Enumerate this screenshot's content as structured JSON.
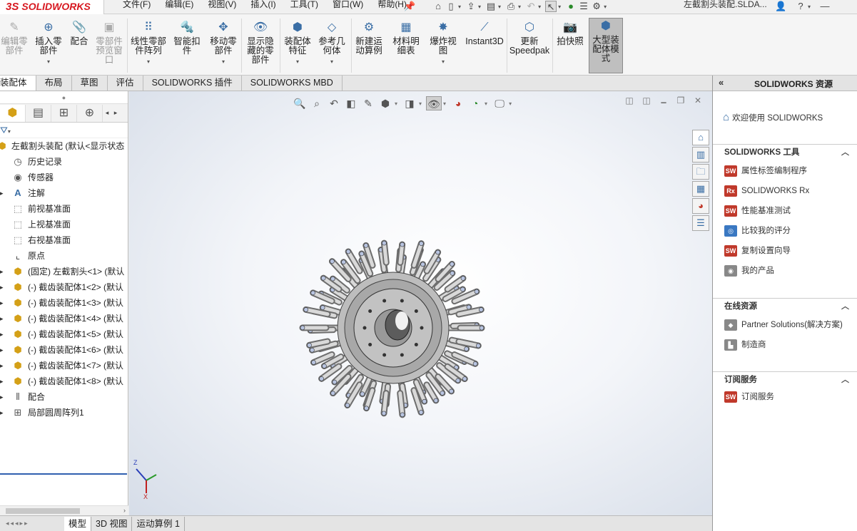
{
  "app": {
    "logo_prefix": "3S",
    "logo_text": "SOLIDWORKS",
    "document_title": "左截割头装配.SLDA..."
  },
  "menu": [
    "文件(F)",
    "编辑(E)",
    "视图(V)",
    "插入(I)",
    "工具(T)",
    "窗口(W)",
    "帮助(H)"
  ],
  "ribbon": {
    "items": [
      {
        "id": "edit-component",
        "label": "编辑零\n部件",
        "disabled": true
      },
      {
        "id": "insert-component",
        "label": "插入零\n部件",
        "dropdown": true
      },
      {
        "id": "mate",
        "label": "配合"
      },
      {
        "id": "component-preview",
        "label": "零部件\n预览窗\n口",
        "disabled": true
      },
      {
        "id": "linear-pattern",
        "label": "线性零部\n件阵列",
        "dropdown": true
      },
      {
        "id": "smart-fasteners",
        "label": "智能扣\n件"
      },
      {
        "id": "move-component",
        "label": "移动零\n部件",
        "dropdown": true
      },
      {
        "id": "show-hidden",
        "label": "显示隐\n藏的零\n部件"
      },
      {
        "id": "assembly-features",
        "label": "装配体\n特征",
        "dropdown": true
      },
      {
        "id": "reference-geometry",
        "label": "参考几\n何体",
        "dropdown": true
      },
      {
        "id": "new-motion-study",
        "label": "新建运\n动算例"
      },
      {
        "id": "bom",
        "label": "材料明\n细表"
      },
      {
        "id": "exploded-view",
        "label": "爆炸视\n图",
        "dropdown": true
      },
      {
        "id": "instant3d",
        "label": "Instant3D"
      },
      {
        "id": "update-speedpak",
        "label": "更新\nSpeedpak"
      },
      {
        "id": "snapshot",
        "label": "拍快照"
      },
      {
        "id": "large-assembly",
        "label": "大型装\n配体模\n式",
        "active": true
      }
    ]
  },
  "tabs": [
    "装配体",
    "布局",
    "草图",
    "评估",
    "SOLIDWORKS 插件",
    "SOLIDWORKS MBD"
  ],
  "feature_tree": {
    "root": "左截割头装配  (默认<显示状态",
    "nodes": [
      {
        "label": "历史记录",
        "icon": "history-icon"
      },
      {
        "label": "传感器",
        "icon": "sensor-icon"
      },
      {
        "label": "注解",
        "icon": "annotation-icon",
        "expandable": true
      },
      {
        "label": "前视基准面",
        "icon": "plane-icon"
      },
      {
        "label": "上视基准面",
        "icon": "plane-icon"
      },
      {
        "label": "右视基准面",
        "icon": "plane-icon"
      },
      {
        "label": "原点",
        "icon": "origin-icon"
      },
      {
        "label": "(固定) 左截割头<1> (默认",
        "icon": "part-icon",
        "expandable": true
      },
      {
        "label": "(-) 截齿装配体1<2> (默认",
        "icon": "subassembly-icon",
        "expandable": true
      },
      {
        "label": "(-) 截齿装配体1<3> (默认",
        "icon": "subassembly-icon",
        "expandable": true
      },
      {
        "label": "(-) 截齿装配体1<4> (默认",
        "icon": "subassembly-icon",
        "expandable": true
      },
      {
        "label": "(-) 截齿装配体1<5> (默认",
        "icon": "subassembly-icon",
        "expandable": true
      },
      {
        "label": "(-) 截齿装配体1<6> (默认",
        "icon": "subassembly-icon",
        "expandable": true
      },
      {
        "label": "(-) 截齿装配体1<7> (默认",
        "icon": "subassembly-icon",
        "expandable": true
      },
      {
        "label": "(-) 截齿装配体1<8> (默认",
        "icon": "subassembly-icon",
        "expandable": true
      },
      {
        "label": "配合",
        "icon": "mate-icon",
        "expandable": true
      },
      {
        "label": "局部圆周阵列1",
        "icon": "circular-pattern-icon",
        "expandable": true
      }
    ]
  },
  "viewport": {
    "triad": {
      "z": "Z",
      "x": "X"
    }
  },
  "bottom_tabs": [
    "模型",
    "3D 视图",
    "运动算例 1"
  ],
  "task_pane": {
    "title": "SOLIDWORKS 资源",
    "welcome": "欢迎使用  SOLIDWORKS",
    "sections": [
      {
        "title": "SOLIDWORKS 工具",
        "items": [
          "属性标签编制程序",
          "SOLIDWORKS Rx",
          "性能基准测试",
          "比较我的评分",
          "复制设置向导",
          "我的产品"
        ]
      },
      {
        "title": "在线资源",
        "items": [
          "Partner Solutions(解决方案)",
          "制造商"
        ]
      },
      {
        "title": "订阅服务",
        "items": [
          "订阅服务"
        ]
      }
    ]
  }
}
